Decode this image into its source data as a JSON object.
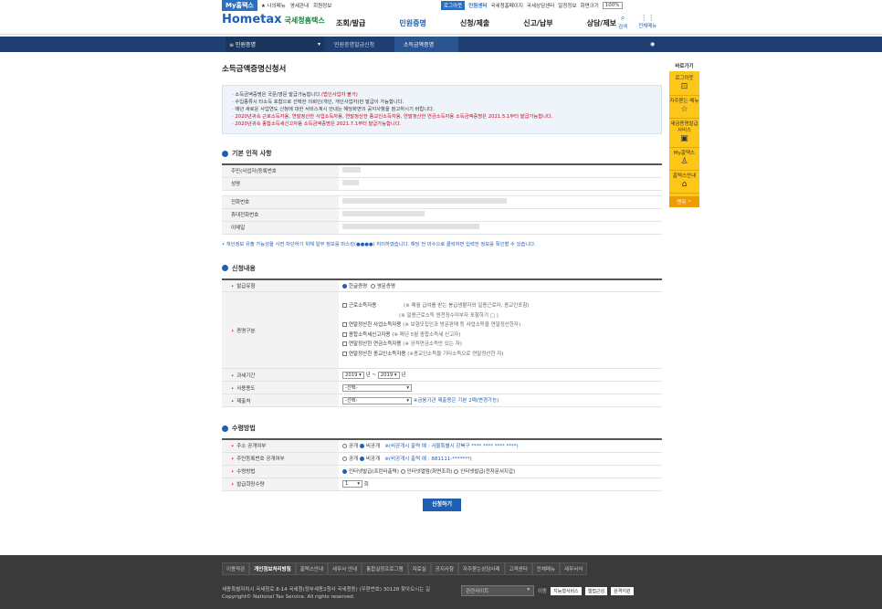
{
  "topbar": {
    "myhome": "My홈택스",
    "links": [
      "★ 나의메뉴",
      "영세관내",
      "회원정보"
    ],
    "right": [
      "로그아웃",
      "민원센터",
      "국세청홈페이지",
      "국세상담센터",
      "일정정보",
      "화면크기",
      "100%"
    ]
  },
  "logo": {
    "main": "Hometax",
    "sub": "국세청홈택스"
  },
  "menu": [
    "조회/발급",
    "민원증명",
    "신청/제출",
    "신고/납부",
    "상담/제보"
  ],
  "menu_icons": [
    "검색",
    "전체메뉴"
  ],
  "subnav": {
    "home": "≡ 민원증명",
    "crumb1": "민원증명발급신청",
    "crumb2": "소득금액증명"
  },
  "page_title": "소득금액증명신청서",
  "notice": [
    {
      "text": "소득금액증명은 국문/영문 발급가능합니다.",
      "red": "(법인사업자 불가)"
    },
    {
      "text": "수입종류시 타소득 포함으로 선택한 의뢰인(개인, 개인사업자)만 발급이 가능합니다.",
      "red": ""
    },
    {
      "text": "매년 새로운 사업연도 신청에 대한 서비스계시 안내는 해당화면의 공지사항을 참고하시기 바랍니다.",
      "red": ""
    },
    {
      "text": "2020년귀속 근로소득자용, 연말정산한 사업소득자용, 연말정산한 종교인소득자용, 연말정산한 연금소득자용 소득금액증명은 2021.5.1부터 발급가능합니다.",
      "red": ""
    },
    {
      "text": "2020년귀속 종합소득세신고자용 소득금액증명은 2021.7.1부터 발급가능합니다.",
      "red": ""
    }
  ],
  "section1": {
    "title": "기본 인적 사항",
    "rows": [
      "주민(사업자)등록번호",
      "성명",
      "전화번호",
      "휴대전화번호",
      "이메일"
    ]
  },
  "mask_note": "• 개인정보 유출 가능성을 사전 차단하기 위해 일부 정보를 마스킹(●●●●) 처리하였습니다. 해당 전 미수으로 클릭하면 입력한 정보를 확인할 수 있습니다.",
  "section2": {
    "title": "신청내용",
    "issue_type": {
      "label": "발급유형",
      "options": [
        "한글증명",
        "영문증명"
      ]
    },
    "cert_type": {
      "label": "증명구분",
      "options": [
        {
          "text": "근로소득자용",
          "hint": "(※ 매월 급여를 받는 봉급생활자와 일용근로자, 종교인포함)"
        },
        {
          "text": "",
          "hint": "(※ 일용근로소득 원천징수미부자 포함하기 □ )"
        },
        {
          "text": "연말정산한 사업소득자용",
          "hint": "(※ 보험모집인과 방문판매 등 사업소득을 연말정산한자)"
        },
        {
          "text": "종합소득세신고자용",
          "hint": "(※ 매년 5월 종합소득세 신고자)"
        },
        {
          "text": "연말정산한 연금소득자용",
          "hint": "(※ 공적연금소득만 있는 자)"
        },
        {
          "text": "연말정산한 종교인소득자용",
          "hint": "(※종교인소득을 기타소득으로 연말정산한 자)"
        }
      ]
    },
    "period": {
      "label": "과세기간",
      "from": "2019",
      "to": "2019",
      "unit": "년",
      "dash": "~"
    },
    "purpose": {
      "label": "사용용도",
      "value": "-선택-"
    },
    "submit_to": {
      "label": "제출처",
      "value": "-선택-",
      "hint": "※금융기관 제출용은 기본 2매(변경가능)"
    }
  },
  "section3": {
    "title": "수령방법",
    "address": {
      "label": "주소 공개여부",
      "options": [
        "공개",
        "비공개"
      ],
      "hint": "※(비공개시 출력 예 : 서울특별시 강북구 **** **** **** ****)"
    },
    "rrn": {
      "label": "주민등록번호 공개여부",
      "options": [
        "공개",
        "비공개"
      ],
      "hint": "※(비공개시 출력 예 : 881111-*******)"
    },
    "method": {
      "label": "수령방법",
      "options": [
        "인터넷발급(프린터출력)",
        "인터넷열람(화면조회)",
        "인터넷발급(전자문서지갑)"
      ]
    },
    "qty": {
      "label": "발급희망수량",
      "value": "1",
      "unit": "회"
    }
  },
  "submit": "신청하기",
  "sidebar": {
    "title": "바로가기",
    "items": [
      "로그아웃",
      "자주묻는 메뉴",
      "세금증명발급서비스",
      "My홈택스",
      "홈택스안내"
    ],
    "top": "맨위 ^"
  },
  "footer": {
    "links": [
      "이용약관",
      "개인정보처리방침",
      "홈택스안내",
      "세무서 안내",
      "통합실정프로그램",
      "자료실",
      "공지사항",
      "자주묻는상담사례",
      "고객센터",
      "전체메뉴",
      "세무서식"
    ],
    "address": "세종특별자치시 국세청로 8-14 국세청(정부세종2청사 국세청동) (우편번호) 30128  찾아오시는 길",
    "copyright": "Copyright© National Tax Service. All rights reserved.",
    "related": "관련사이트",
    "go": "이동",
    "badges": [
      "지능형서비스",
      "웹접근성",
      "원격지원"
    ]
  },
  "colors": {
    "primary": "#1e5fb4",
    "nav": "#1f3f72",
    "side": "#ffc61a",
    "red": "#d0021b",
    "footer": "#3a3a3a"
  }
}
